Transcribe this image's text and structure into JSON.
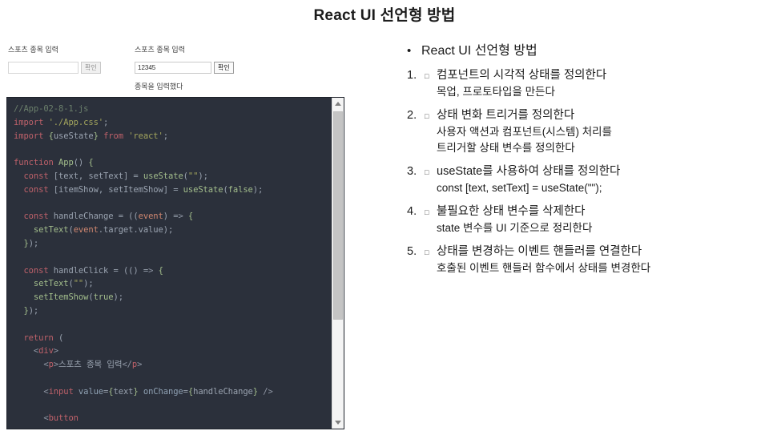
{
  "slide": {
    "title": "React UI 선언형 방법"
  },
  "demo": {
    "before": {
      "label": "스포츠 종목 입력",
      "input_value": "",
      "input_placeholder": "",
      "button_label": "확인",
      "button_disabled": true,
      "message": ""
    },
    "after": {
      "label": "스포츠 종목 입력",
      "input_value": "12345",
      "input_placeholder": "",
      "button_label": "확인",
      "button_disabled": false,
      "message": "종목을 입력했다"
    }
  },
  "code": {
    "filename": "//App-02-8-1.js",
    "scrollbar": {
      "up_arrow": "scroll-up-arrow",
      "down_arrow": "scroll-down-arrow",
      "thumb_position_percent": 0,
      "thumb_size_percent": 68
    },
    "lines": [
      "//App-02-8-1.js",
      "import './App.css';",
      "import {useState} from 'react';",
      "",
      "function App() {",
      "  const [text, setText] = useState(\"\");",
      "  const [itemShow, setItemShow] = useState(false);",
      "",
      "  const handleChange = ((event) => {",
      "    setText(event.target.value);",
      "  });",
      "",
      "  const handleClick = (() => {",
      "    setText(\"\");",
      "    setItemShow(true);",
      "  });",
      "",
      "  return (",
      "    <div>",
      "      <p>스포츠 종목 입력</p>",
      "",
      "      <input value={text} onChange={handleChange} />",
      "",
      "      <button"
    ]
  },
  "outline": {
    "bullet_glyph": "•",
    "checkbox_glyph": "□",
    "heading": "React UI 선언형 방법",
    "items": [
      {
        "number": "1.",
        "line1": "컴포넌트의 시각적 상태를 정의한다",
        "line2": "목업, 프로토타입을 만든다"
      },
      {
        "number": "2.",
        "line1": "상태 변화 트리거를 정의한다",
        "line2": "사용자 액션과 컴포넌트(시스템) 처리를",
        "line3": "트리거할 상태 변수를 정의한다"
      },
      {
        "number": "3.",
        "line1": "useState를 사용하여 상태를 정의한다",
        "line2": "const [text, setText] = useState(\"\");"
      },
      {
        "number": "4.",
        "line1": "불필요한 상태 변수를 삭제한다",
        "line2": "state 변수를 UI 기준으로 정리한다"
      },
      {
        "number": "5.",
        "line1": "상태를 변경하는 이벤트 핸들러를 연결한다",
        "line2": "호출된 이벤트 핸들러 함수에서 상태를 변경한다"
      }
    ]
  },
  "colors": {
    "editor_background": "#2b303b",
    "editor_foreground": "#c0c5ce",
    "keyword": "#bf616a",
    "string": "#a3a55d",
    "comment": "#6b7f6b",
    "function_name": "#a3be8c",
    "attribute": "#8fa1b3",
    "scrollbar_thumb": "#c4c4c4",
    "page_background": "#ffffff",
    "text": "#1b1b1b"
  }
}
